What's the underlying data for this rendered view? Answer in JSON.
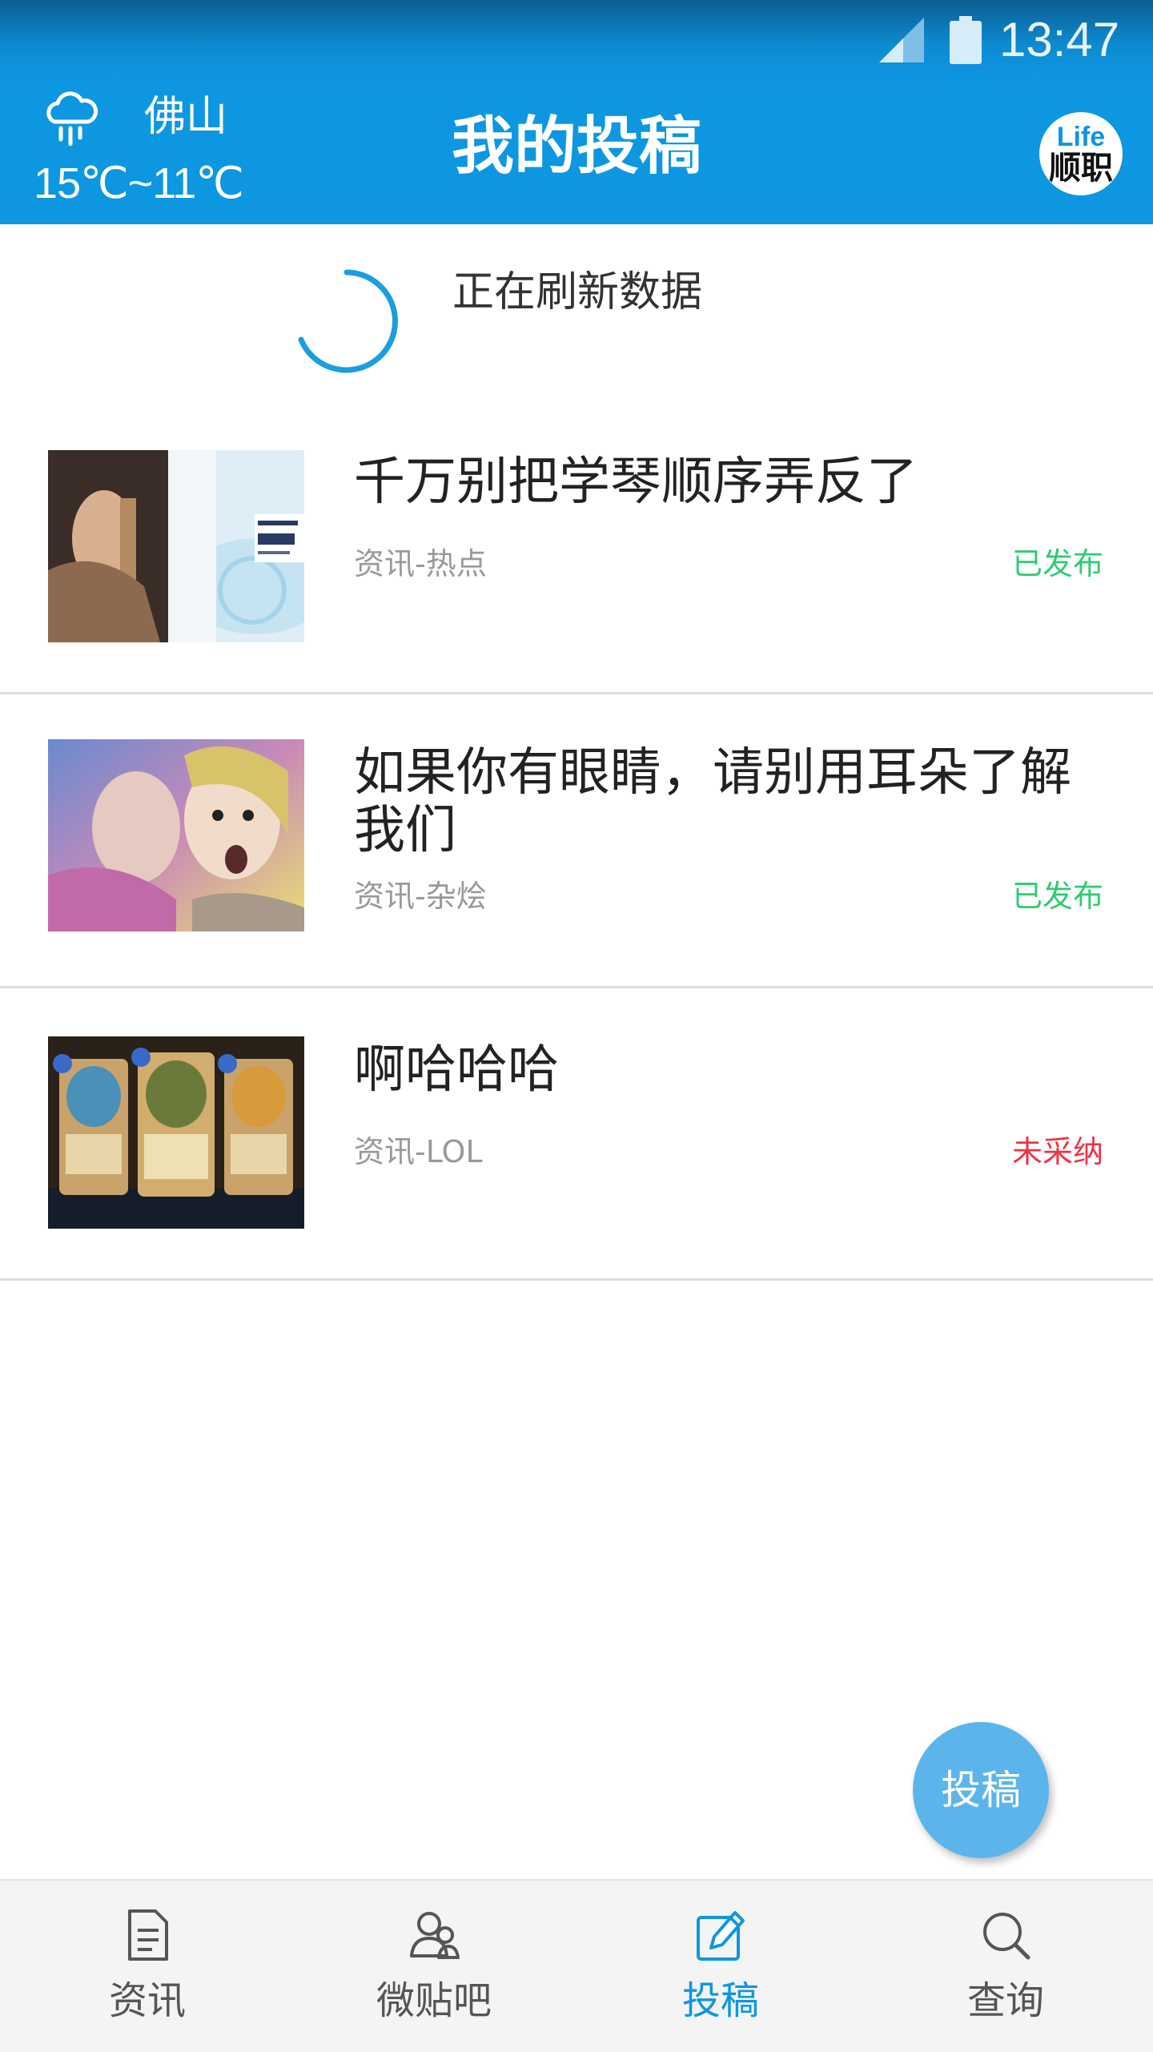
{
  "status_bar": {
    "time": "13:47",
    "signal_icon": "signal-icon",
    "battery_icon": "battery-icon"
  },
  "header": {
    "city": "佛山",
    "temperature": "15℃~11℃",
    "weather_icon": "rain-cloud-icon",
    "title": "我的投稿",
    "logo_line1": "Life",
    "logo_line2": "顺职"
  },
  "refresh": {
    "text": "正在刷新数据"
  },
  "items": [
    {
      "title": "千万别把学琴顺序弄反了",
      "category": "资讯-热点",
      "status": "已发布",
      "status_color": "#2ecc71"
    },
    {
      "title": "如果你有眼睛，请别用耳朵了解我们",
      "category": "资讯-杂烩",
      "status": "已发布",
      "status_color": "#2ecc71"
    },
    {
      "title": "啊哈哈哈",
      "category": "资讯-LOL",
      "status": "未采纳",
      "status_color": "#ee3344"
    }
  ],
  "fab": {
    "label": "投稿"
  },
  "bottom_nav": [
    {
      "label": "资讯",
      "icon": "document-icon",
      "active": false
    },
    {
      "label": "微贴吧",
      "icon": "users-icon",
      "active": false
    },
    {
      "label": "投稿",
      "icon": "edit-icon",
      "active": true
    },
    {
      "label": "查询",
      "icon": "search-icon",
      "active": false
    }
  ],
  "colors": {
    "primary": "#0d97e0",
    "published": "#2ecc71",
    "rejected": "#ee3344",
    "nav_inactive": "#555555"
  }
}
